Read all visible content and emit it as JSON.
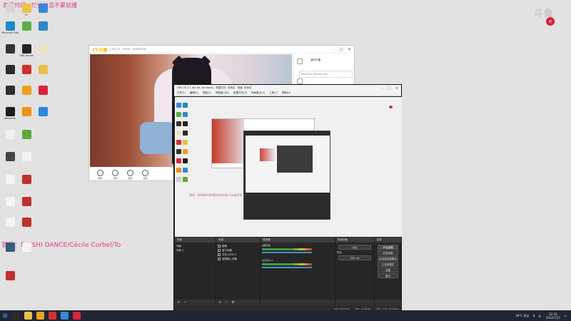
{
  "overlay": {
    "time_text": "直播时间：忙忙并且不累就播",
    "music_text": "音乐：DAISHI DANCE/Cécile Corbel/To",
    "brand": "斗鱼",
    "badge": "e"
  },
  "desktop_icons": [
    {
      "label": "",
      "color": "#d7d7d7",
      "icon": "blank-icon"
    },
    {
      "label": "CF",
      "color": "#efc34a",
      "icon": "folder-icon"
    },
    {
      "label": "",
      "color": "#3a87d8",
      "icon": "windows-icon"
    },
    {
      "label": "Microsoft Edge",
      "color": "#1e88c7",
      "icon": "edge-icon"
    },
    {
      "label": "",
      "color": "#5bb04a",
      "icon": "settings-icon"
    },
    {
      "label": "",
      "color": "#2d89c9",
      "icon": "monitor-icon"
    },
    {
      "label": "",
      "color": "#333333",
      "icon": "obs-icon"
    },
    {
      "label": "OBS Studio",
      "color": "#222222",
      "icon": "obs-studio-icon"
    },
    {
      "label": "",
      "color": "#e9e3c3",
      "icon": "file-icon"
    },
    {
      "label": "",
      "color": "#2a2a2a",
      "icon": "qq-icon"
    },
    {
      "label": "",
      "color": "#d22f2f",
      "icon": "netease-icon"
    },
    {
      "label": "",
      "color": "#e8c04a",
      "icon": "folder-icon"
    },
    {
      "label": "",
      "color": "#2f2f2f",
      "icon": "qq-game-icon"
    },
    {
      "label": "",
      "color": "#f0a020",
      "icon": "app-icon"
    },
    {
      "label": "",
      "color": "#d8243b",
      "icon": "music-icon"
    },
    {
      "label": "WeGame",
      "color": "#1d1d1d",
      "icon": "wegame-icon"
    },
    {
      "label": "",
      "color": "#f08f1a",
      "icon": "game-icon"
    },
    {
      "label": "",
      "color": "#2b8ad9",
      "icon": "kugou-icon"
    },
    {
      "label": "",
      "color": "#f1f1f1",
      "icon": "document-icon"
    },
    {
      "label": "",
      "color": "#5fa83a",
      "icon": "excel-icon"
    },
    {
      "label": "",
      "color": "#444444",
      "icon": "screen-icon"
    },
    {
      "label": "",
      "color": "#f4f4f4",
      "icon": "doc-icon"
    },
    {
      "label": "",
      "color": "#f4f4f4",
      "icon": "doc-icon"
    },
    {
      "label": "",
      "color": "#c03030",
      "icon": "doc-red-icon"
    },
    {
      "label": "",
      "color": "#f4f4f4",
      "icon": "doc-icon"
    },
    {
      "label": "",
      "color": "#c03030",
      "icon": "doc-red-icon"
    },
    {
      "label": "",
      "color": "#f4f4f4",
      "icon": "doc-icon"
    },
    {
      "label": "",
      "color": "#c03030",
      "icon": "doc-red-icon"
    },
    {
      "label": "",
      "color": "#5b6b4a",
      "icon": "game-icon"
    },
    {
      "label": "",
      "color": "#f4f4f4",
      "icon": "doc-icon"
    },
    {
      "label": "",
      "color": "#c03030",
      "icon": "doc-red-icon"
    },
    {
      "label": "",
      "color": "#2f5f7f",
      "icon": "app-icon"
    }
  ],
  "yy": {
    "logo": "YY开播",
    "version": "1.20.1.0 · 10030 · 00507038",
    "controls": [
      "美颜",
      "滤镜",
      "贴纸",
      "设置"
    ],
    "side_title": "我的开播",
    "side_item": "2022 Pro Stream Fra..."
  },
  "obs": {
    "title": "OBS 28.1.1 (64-bit, windows) - 配置文件: 未命名 - 场景: 未命名",
    "menu": [
      "文件(F)",
      "编辑(E)",
      "视图(V)",
      "停靠窗口(D)",
      "配置文件(P)",
      "场景集合(S)",
      "工具(T)",
      "帮助(H)"
    ],
    "overlay_text": "音乐：DAISHI DANCE/Cécile Corbel/To",
    "docks": {
      "scenes": {
        "title": "场景",
        "items": [
          "场景",
          "场景 2"
        ]
      },
      "sources": {
        "title": "来源",
        "items": [
          "图像",
          "窗口采集",
          "文本 (GDI+)",
          "音频输入采集"
        ]
      },
      "mixer": {
        "title": "混音器",
        "tracks": [
          "桌面音频",
          "麦克风/Aux"
        ]
      },
      "transitions": {
        "title": "转场动画",
        "value": "淡出",
        "duration_label": "时长",
        "duration": "300 ms"
      },
      "controls": {
        "title": "控件",
        "buttons": [
          "开始直播",
          "开始录制",
          "启动虚拟摄像机",
          "工作室模式",
          "设置",
          "退出"
        ]
      }
    },
    "status": [
      "LIVE: 00:00:00",
      "REC: 00:00:00",
      "CPU: 3.2%, 30.00 fps"
    ]
  },
  "taskbar": {
    "start_icon": "⊞",
    "weather": "28°C 多云",
    "time": "22:18",
    "date": "2022/7/21"
  }
}
